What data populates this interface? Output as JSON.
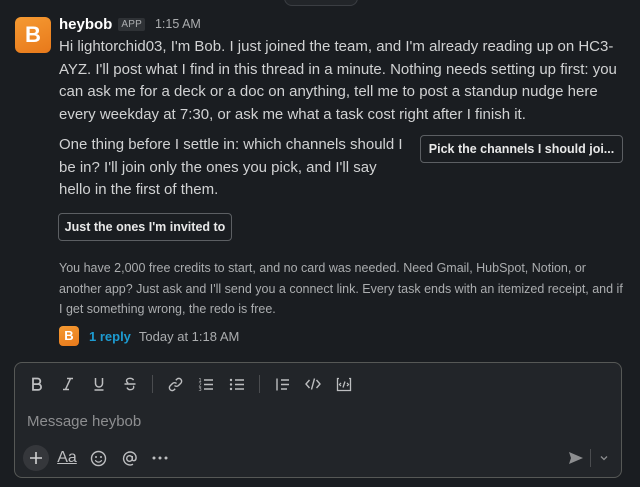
{
  "message": {
    "avatar_letter": "B",
    "sender": "heybob",
    "badge": "APP",
    "time": "1:15 AM",
    "paragraph1": "Hi lightorchid03, I'm Bob. I just joined the team, and I'm already reading up on HC3-AYZ. I'll post what I find in this thread in a minute. Nothing needs setting up first: you can ask me for a deck or a doc on anything, tell me to post a standup nudge here every weekday at 7:30, or ask me what a task cost right after I finish it.",
    "paragraph2": "One thing before I settle in: which channels should I be in? I'll join only the ones you pick, and I'll say hello in the first of them.",
    "pick_channels_button": "Pick the channels I should joi...",
    "invited_only_button": "Just the ones I'm invited to",
    "fineprint": "You have 2,000 free credits to start, and no card was needed. Need Gmail, HubSpot, Notion, or another app? Just ask and I'll send you a connect link. Every task ends with an itemized receipt, and if I get something wrong, the redo is free.",
    "reply_avatar_letter": "B",
    "reply_count": "1 reply",
    "reply_time": "Today at 1:18 AM"
  },
  "composer": {
    "placeholder": "Message heybob",
    "toolbar": [
      "bold-icon",
      "italic-icon",
      "underline-icon",
      "strikethrough-icon",
      "link-icon",
      "ordered-list-icon",
      "bulleted-list-icon",
      "blockquote-icon",
      "code-icon",
      "code-block-icon"
    ],
    "bottom": [
      "plus-icon",
      "formatting-icon",
      "emoji-icon",
      "mention-icon",
      "more-icon"
    ],
    "format_label": "Aa"
  },
  "colors": {
    "background": "#1a1d21",
    "avatar": "#f08a24",
    "link": "#1d9bd1",
    "text": "#d1d2d3"
  }
}
